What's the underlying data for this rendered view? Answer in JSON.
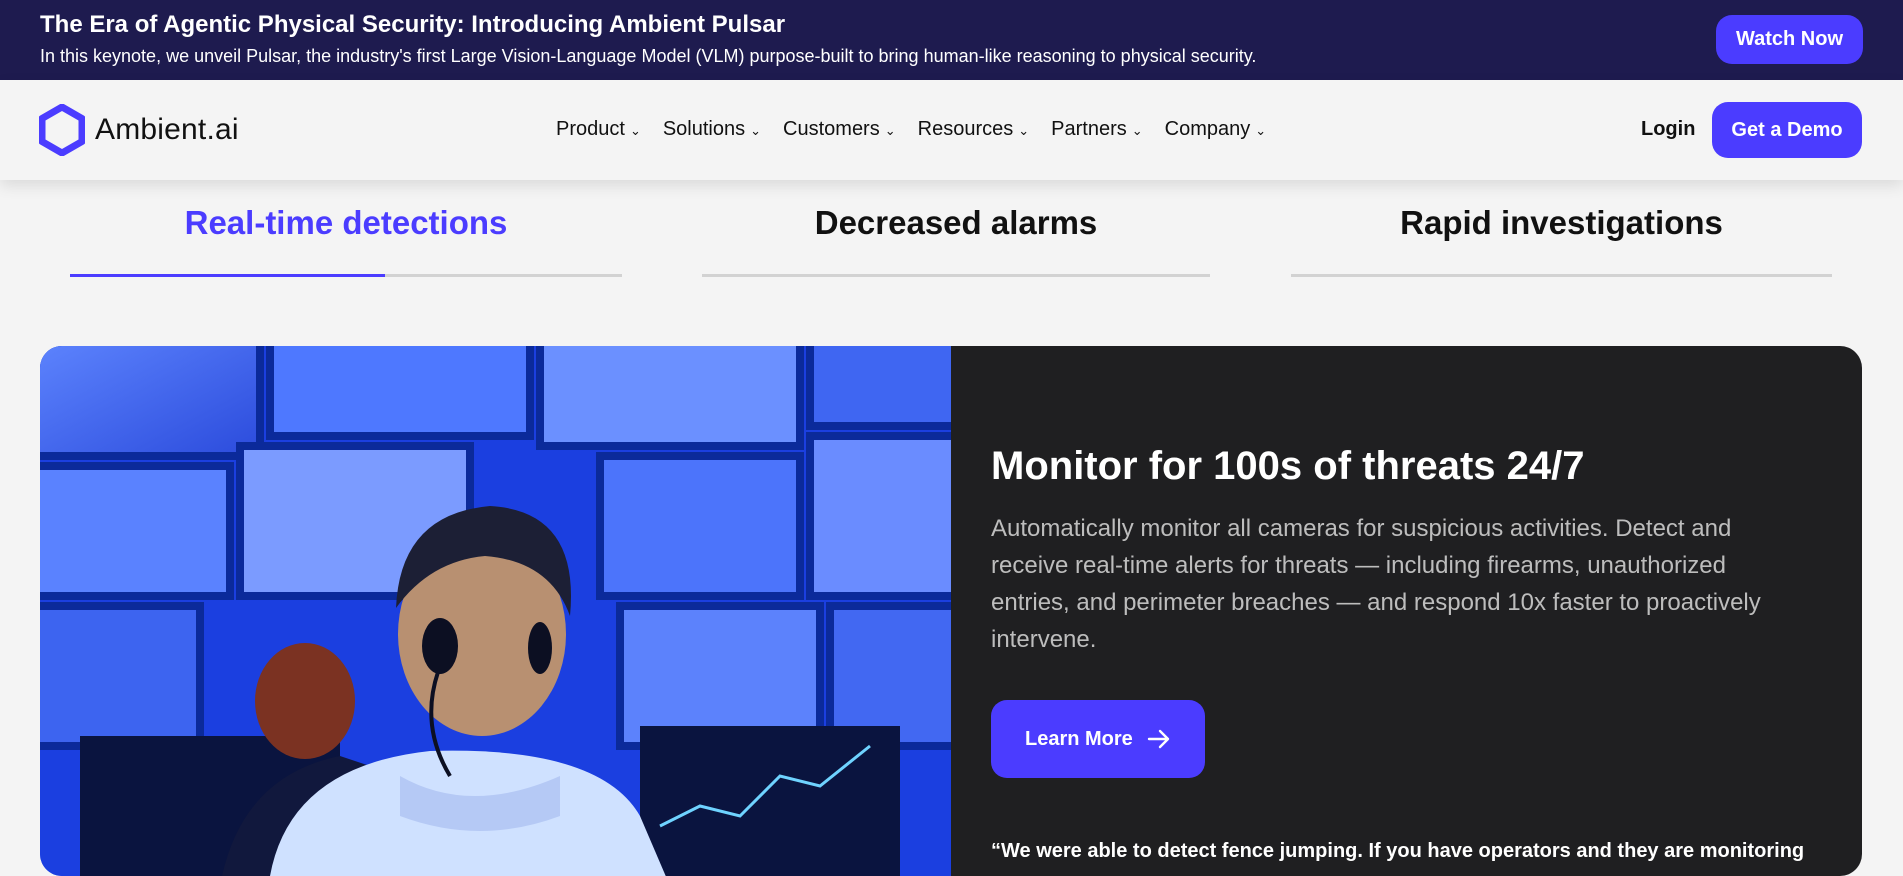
{
  "announcement": {
    "title": "The Era of Agentic Physical Security: Introducing Ambient Pulsar",
    "description": "In this keynote, we unveil Pulsar, the industry's first Large Vision-Language Model (VLM) purpose-built to bring human-like reasoning to physical security.",
    "cta": "Watch Now"
  },
  "nav": {
    "logo": "Ambient.ai",
    "items": [
      "Product",
      "Solutions",
      "Customers",
      "Resources",
      "Partners",
      "Company"
    ],
    "login": "Login",
    "demo": "Get a Demo"
  },
  "tabs": [
    {
      "label": "Real-time detections",
      "active": true,
      "progress": 0.57
    },
    {
      "label": "Decreased alarms",
      "active": false,
      "progress": 0
    },
    {
      "label": "Rapid investigations",
      "active": false,
      "progress": 0
    }
  ],
  "feature": {
    "heading": "Monitor for 100s of threats 24/7",
    "body": "Automatically monitor all cameras for suspicious activities. Detect and receive real-time alerts for threats — including firearms, unauthorized entries, and perimeter breaches — and respond 10x faster to proactively intervene.",
    "cta": "Learn More",
    "quote": "“We were able to detect fence jumping. If you have operators and they are monitoring"
  },
  "colors": {
    "accent": "#4b3cff",
    "announcement_bg": "#1e1b4f",
    "panel_bg": "#1f1f21"
  }
}
